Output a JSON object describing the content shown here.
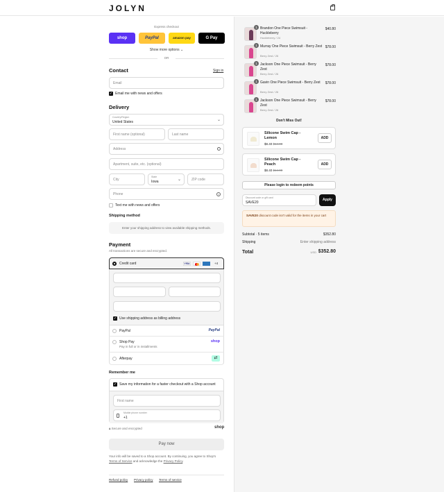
{
  "header": {
    "brand": "JOLYN",
    "cart_icon": "bag-icon"
  },
  "express": {
    "title": "Express checkout",
    "buttons": [
      {
        "label": "shop",
        "bg": "#5a31f4",
        "color": "#ffffff"
      },
      {
        "label": "PayPal",
        "bg": "#ffc439",
        "color": "#253b80"
      },
      {
        "label": "amazon pay",
        "bg": "#ffd814",
        "color": "#222222"
      },
      {
        "label": "G Pay",
        "bg": "#000000",
        "color": "#ffffff"
      }
    ],
    "more": "Show more options",
    "or": "OR"
  },
  "contact": {
    "title": "Contact",
    "signin": "Sign in",
    "email_placeholder": "Email",
    "news_label": "Email me with news and offers"
  },
  "delivery": {
    "title": "Delivery",
    "country_label": "Country/Region",
    "country_value": "United States",
    "first_name": "First name (optional)",
    "last_name": "Last name",
    "address": "Address",
    "apartment": "Apartment, suite, etc. (optional)",
    "city": "City",
    "state_label": "State",
    "state_value": "Iowa",
    "zip": "ZIP code",
    "phone": "Phone",
    "text_label": "Text me with news and offers"
  },
  "shipping": {
    "title": "Shipping method",
    "notice": "Enter your shipping address to view available shipping methods."
  },
  "payment": {
    "title": "Payment",
    "subtitle": "All transactions are secure and encrypted.",
    "credit_card": "Credit card",
    "more_cards": "+4",
    "card_icons": [
      "visa-icon",
      "mastercard-icon",
      "amex-icon"
    ],
    "billing_label": "Use shipping address as billing address",
    "paypal": "PayPal",
    "shop_pay": "Shop Pay",
    "shop_pay_sub": "Pay in full or in installments",
    "shop_pay_logo": "shop",
    "afterpay": "Afterpay"
  },
  "remember": {
    "title": "Remember me",
    "save_label": "Save my information for a faster checkout with a Shop account",
    "first_name": "First name",
    "phone_label": "Mobile phone number",
    "phone_value": "+1",
    "secure": "Secure and encrypted",
    "shop_logo": "shop"
  },
  "pay_now": "Pay now",
  "legal": {
    "t1": "Your info will be saved to a Shop account. By continuing, you agree to",
    "t2a": "Shop's",
    "terms": "Terms of Service",
    "t2b": "and acknowledge the",
    "privacy": "Privacy Policy",
    "t2c": "."
  },
  "footer_links": [
    "Refund policy",
    "Privacy policy",
    "Terms of service"
  ],
  "cart": {
    "items": [
      {
        "name": "Brandon One Piece Swimsuit - Huckleberry",
        "variant": "Huckleberry / 24",
        "price": "$40.80",
        "qty": "1",
        "color": "#6b3a58"
      },
      {
        "name": "Murray One Piece Swimsuit - Berry Zest",
        "variant": "Berry Zest / 26",
        "price": "$78.00",
        "qty": "1",
        "color": "#d9468f"
      },
      {
        "name": "Jackson One Piece Swimsuit - Berry Zest",
        "variant": "Berry Zest / 26",
        "price": "$78.00",
        "qty": "1",
        "color": "#d9468f"
      },
      {
        "name": "Gavin One Piece Swimsuit - Berry Zest",
        "variant": "Berry Zest / 26",
        "price": "$78.00",
        "qty": "1",
        "color": "#d9468f"
      },
      {
        "name": "Jackson One Piece Swimsuit - Berry Zest",
        "variant": "Berry Zest / 26",
        "price": "$78.00",
        "qty": "1",
        "color": "#d9468f"
      }
    ],
    "dont_miss": "Don't Miss Out!",
    "upsells": [
      {
        "name": "Silicone Swim Cap - Lemon",
        "price": "$8.40",
        "compare": "$14.00",
        "add": "ADD"
      },
      {
        "name": "Silicone Swim Cap - Peach",
        "price": "$8.40",
        "compare": "$14.00",
        "add": "ADD"
      }
    ],
    "login_redeem": "Please login to redeem points",
    "discount_label": "Discount code or gift card",
    "discount_value": "SAVE20",
    "apply": "Apply",
    "error_code": "SAVE20",
    "error_text": "discount code isn't valid for the items in your cart",
    "subtotal_label": "Subtotal · 5 items",
    "subtotal_value": "$352.80",
    "shipping_label": "Shipping",
    "shipping_value": "Enter shipping address",
    "total_label": "Total",
    "currency": "USD",
    "total_value": "$352.80"
  }
}
